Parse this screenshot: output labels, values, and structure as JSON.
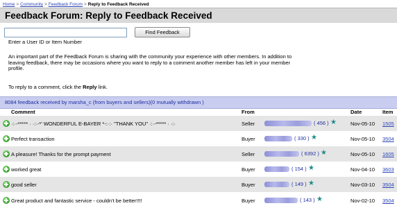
{
  "breadcrumb": {
    "home": "Home",
    "community": "Community",
    "forum": "Feedback Forum",
    "current": "Reply to Feedback Received",
    "sep": ">"
  },
  "title": "Feedback Forum: Reply to Feedback Received",
  "search": {
    "placeholder": "",
    "button": "Find Feedback",
    "hint": "Enter a User ID or Item Number"
  },
  "intro": "An important part of the Feedback Forum is sharing with the community your experience with other members. In addition to leaving feedback, there may be occasions where you want to reply to a comment another member has left in your member profile.",
  "instruction": {
    "before": "To reply to a comment, click the ",
    "bold": "Reply",
    "after": " link."
  },
  "summary": "8084 feedback received by marsha_c (from buyers and sellers)(0 mutually withdrawn )",
  "columns": {
    "comment": "Comment",
    "from": "From",
    "date": "Date",
    "item": "Item"
  },
  "rows": [
    {
      "comment": "·:·-***** · ·:·-*' WONDERFUL E-BAYER *-:·:· \"THANK YOU\" ·:·-***** · ·:·",
      "role": "Seller",
      "score": "( 456 )",
      "date": "Nov-05-10",
      "item": "1505"
    },
    {
      "comment": "Perfect transaction",
      "role": "Buyer",
      "score": "( 330 )",
      "date": "Nov-05-10",
      "item": "3504"
    },
    {
      "comment": "A pleasure! Thanks for the prompt payment",
      "role": "Seller",
      "score": "( 6392 )",
      "date": "Nov-05-10",
      "item": "1605"
    },
    {
      "comment": "worked great",
      "role": "Buyer",
      "score": "( 154 )",
      "date": "Nov-04-10",
      "item": "3603"
    },
    {
      "comment": "good seller",
      "role": "Buyer",
      "score": "( 149 )",
      "date": "Nov-03-10",
      "item": "3504"
    },
    {
      "comment": "Great product and fantastic service - couldn't be better!!!!",
      "role": "Buyer",
      "score": "( 143 )",
      "date": "Nov-02-10",
      "item": "3504"
    }
  ]
}
